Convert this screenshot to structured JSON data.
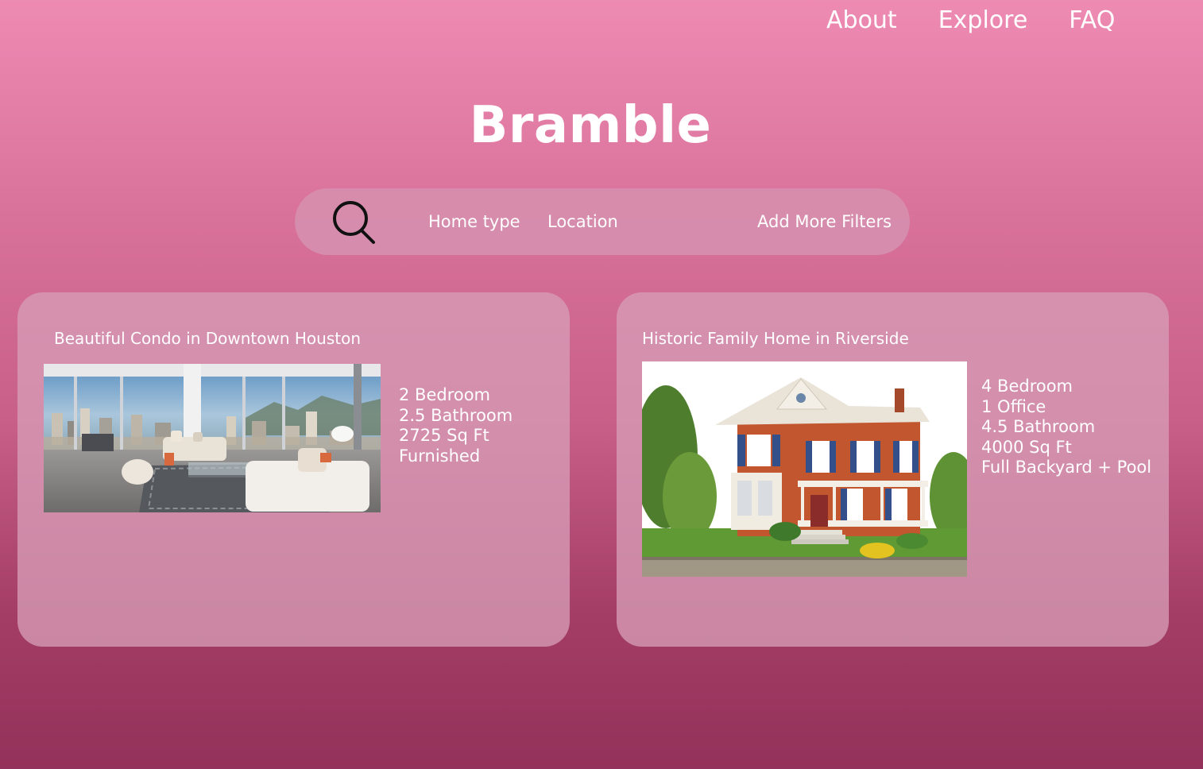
{
  "nav": {
    "items": [
      {
        "label": "About"
      },
      {
        "label": "Explore"
      },
      {
        "label": "FAQ"
      }
    ]
  },
  "brand": {
    "title": "Bramble"
  },
  "search": {
    "icon": "search-icon",
    "filters": {
      "home_type": "Home type",
      "location": "Location",
      "more": "Add More Filters"
    }
  },
  "listings": [
    {
      "title": "Beautiful Condo in Downtown Houston",
      "photo": "condo-living-room-photo",
      "features": [
        "2 Bedroom",
        "2.5 Bathroom",
        "2725 Sq Ft",
        "Furnished"
      ]
    },
    {
      "title": "Historic Family Home in Riverside",
      "photo": "victorian-house-photo",
      "features": [
        "4 Bedroom",
        "1 Office",
        "4.5 Bathroom",
        "4000 Sq Ft",
        "Full Backyard + Pool"
      ]
    }
  ],
  "colors": {
    "background_top": "#ee8bb3",
    "background_bottom": "#93325a",
    "card": "#d69cb6",
    "search_bar": "#d68fae",
    "text": "#ffffff"
  }
}
